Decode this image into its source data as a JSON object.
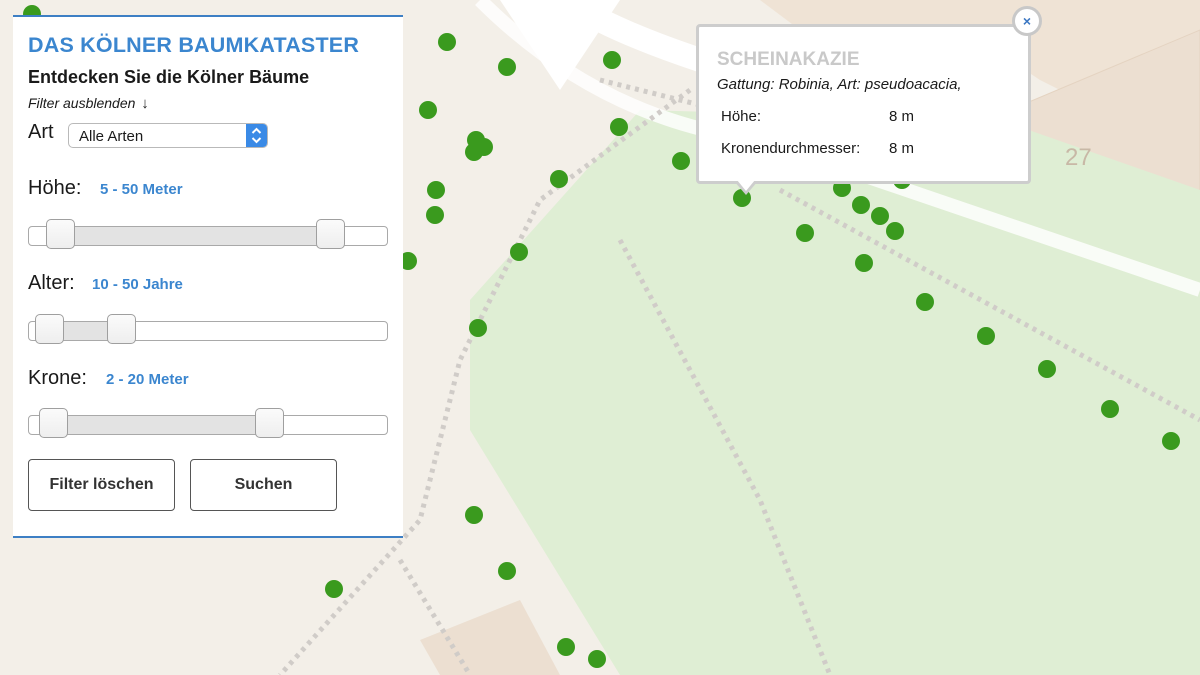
{
  "panel": {
    "title": "DAS KÖLNER BAUMKATASTER",
    "subtitle": "Entdecken Sie die Kölner Bäume",
    "filter_toggle": "Filter ausblenden",
    "filter_toggle_arrow": "↓",
    "species": {
      "label": "Art",
      "selected": "Alle Arten"
    },
    "height": {
      "label": "Höhe:",
      "range": "5 - 50 Meter",
      "handles": [
        0.09,
        0.84
      ]
    },
    "age": {
      "label": "Alter:",
      "range": "10 - 50 Jahre",
      "handles": [
        0.06,
        0.26
      ]
    },
    "crown": {
      "label": "Krone:",
      "range": "2 - 20 Meter",
      "handles": [
        0.07,
        0.67
      ]
    },
    "buttons": {
      "clear": "Filter löschen",
      "search": "Suchen"
    }
  },
  "popup": {
    "title": "SCHEINAKAZIE",
    "genus_line": "Gattung: Robinia, Art: pseudoacacia,",
    "rows": [
      {
        "key": "Höhe:",
        "value": "8 m"
      },
      {
        "key": "Kronendurchmesser:",
        "value": "8 m"
      }
    ],
    "close": "×"
  },
  "map": {
    "house_number": "27",
    "colors": {
      "tree": "#3a9a1e",
      "park": "#dfeed4",
      "road": "#ffffff",
      "building": "#ecdfd1",
      "base": "#f3efe8"
    }
  }
}
